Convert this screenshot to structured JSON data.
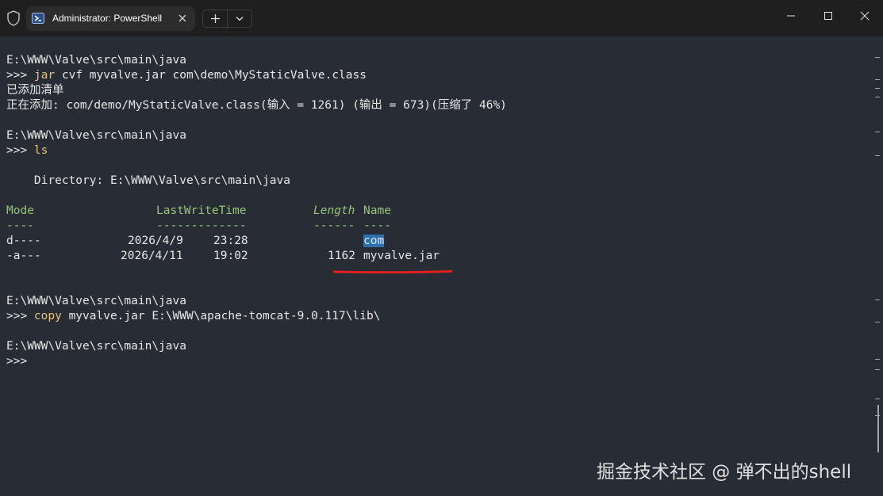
{
  "window": {
    "tab_title": "Administrator: PowerShell",
    "icons": {
      "shield": "shield-icon",
      "tab": "powershell-icon",
      "close_tab": "close-icon",
      "new_tab": "plus-icon",
      "dropdown": "chevron-down-icon",
      "minimize": "minimize-icon",
      "maximize": "maximize-icon",
      "close": "close-icon"
    }
  },
  "terminal": {
    "lines": [
      {
        "prefix": "E:\\WWW\\Valve\\src\\main\\java"
      },
      {
        "prefix": ">>> ",
        "cmd": "jar",
        "rest": " cvf myvalve.jar com\\demo\\MyStaticValve.class"
      },
      {
        "prefix": "已添加清单"
      },
      {
        "prefix": "正在添加: com/demo/MyStaticValve.class(输入 = 1261) (输出 = 673)(压缩了 46%)"
      },
      {
        "prefix": "E:\\WWW\\Valve\\src\\main\\java"
      },
      {
        "prefix": ">>> ",
        "cmd": "ls"
      },
      {
        "prefix": "    Directory: E:\\WWW\\Valve\\src\\main\\java"
      },
      {
        "prefix": "E:\\WWW\\Valve\\src\\main\\java"
      },
      {
        "prefix": ">>> ",
        "cmd": "copy",
        "rest": " myvalve.jar E:\\WWW\\apache-tomcat-9.0.117\\lib\\"
      },
      {
        "prefix": "E:\\WWW\\Valve\\src\\main\\java"
      },
      {
        "prefix": ">>>"
      }
    ],
    "table": {
      "headers": {
        "mode": "Mode",
        "lastwrite": "LastWriteTime",
        "length": "Length",
        "name": "Name"
      },
      "separators": {
        "mode": "----",
        "lastwrite": "-------------",
        "length": "------",
        "name": "----"
      },
      "rows": [
        {
          "mode": "d----",
          "date": "2026/4/9",
          "time": "23:28",
          "length": "",
          "name": "com"
        },
        {
          "mode": "-a---",
          "date": "2026/4/11",
          "time": "19:02",
          "length": "1162",
          "name": "myvalve.jar"
        }
      ]
    },
    "colors": {
      "background": "#282c34",
      "command": "#e5c07b",
      "header": "#98c379",
      "selection": "#2f6fb0",
      "annotation": "#e0201b"
    }
  },
  "watermark": "掘金技术社区 @ 弹不出的shell"
}
